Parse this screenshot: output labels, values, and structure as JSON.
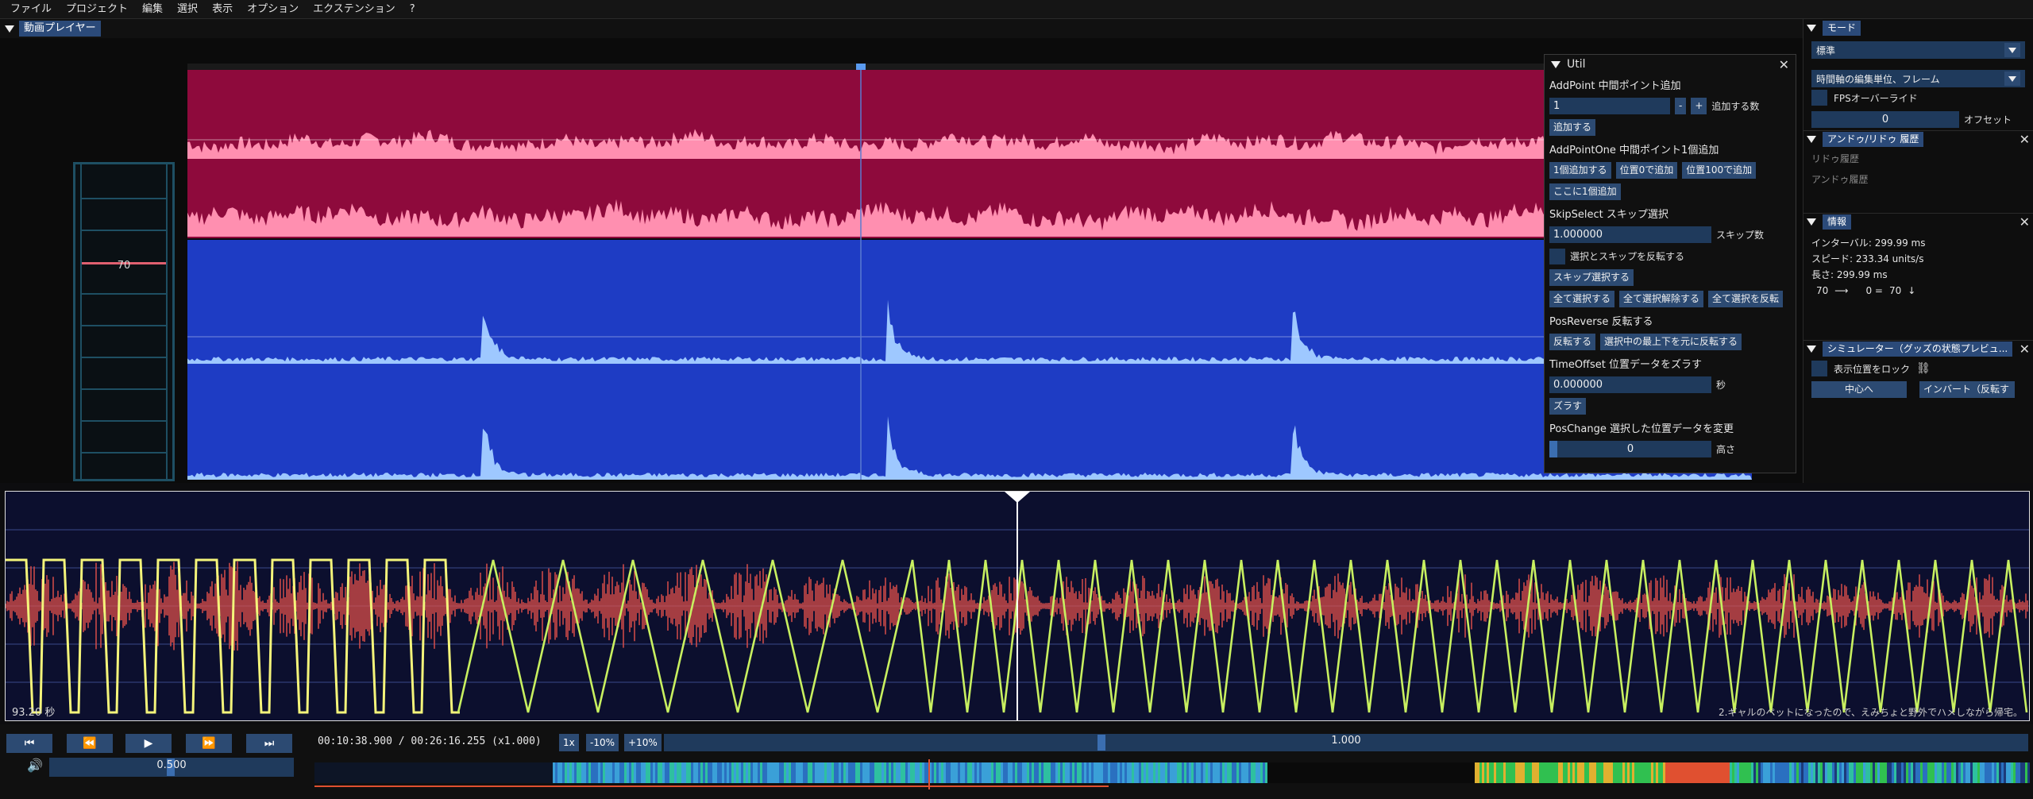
{
  "menu": [
    "ファイル",
    "プロジェクト",
    "編集",
    "選択",
    "表示",
    "オプション",
    "エクステンション",
    "?"
  ],
  "player_tab": "動画プレイヤー",
  "ladder_value": "70",
  "util": {
    "title": "Util",
    "addpoint_title": "AddPoint 中間ポイント追加",
    "addpoint_value": "1",
    "minus": "-",
    "plus": "+",
    "addpoint_count_label": "追加する数",
    "addpoint_btn": "追加する",
    "addpointone_title": "AddPointOne 中間ポイント1個追加",
    "add_one": "1個追加する",
    "pos0": "位置0で追加",
    "pos100": "位置100で追加",
    "add_here": "ここに1個追加",
    "skipselect_title": "SkipSelect スキップ選択",
    "skip_value": "1.000000",
    "skip_label": "スキップ数",
    "invert_label": "選択とスキップを反転する",
    "skip_btn": "スキップ選択する",
    "select_all": "全て選択する",
    "deselect_all": "全て選択解除する",
    "invert_all": "全て選択を反転",
    "posreverse_title": "PosReverse 反転する",
    "reverse_btn": "反転する",
    "reverse_sel_btn": "選択中の最上下を元に反転する",
    "timeoffset_title": "TimeOffset 位置データをズラす",
    "offset_value": "0.000000",
    "offset_unit": "秒",
    "shift_btn": "ズラす",
    "poschange_title": "PosChange 選択した位置データを変更",
    "height_value": "0",
    "height_label": "高さ"
  },
  "right": {
    "mode_tab": "モード",
    "mode_select": "標準",
    "timeunit_select": "時間軸の編集単位、フレーム",
    "fps_override": "FPSオーバーライド",
    "offset_value": "0",
    "offset_label": "オフセット",
    "undo_tab": "アンドゥ/リドゥ 履歴",
    "redo_history": "リドゥ履歴",
    "undo_history": "アンドゥ履歴",
    "info_tab": "情報",
    "interval": "インターバル: 299.99 ms",
    "speed": "スピード: 233.34 units/s",
    "length": "長さ: 299.99 ms",
    "pos_from": "70",
    "pos_mid": "0 =",
    "pos_to": "70",
    "sim_tab": "シミュレーター（グッズの状態プレビュ...",
    "lock_label": "表示位置をロック",
    "center_btn": "中心へ",
    "invert_btn": "インバート（反転す"
  },
  "script": {
    "time_left": "93.20 秒",
    "lyric": "2.ギャルのペットになったので、えみちょと野外でハメしながら帰宅。"
  },
  "transport": {
    "time": "00:10:38.900 / 00:26:16.255 (x1.000)",
    "speed_1x": "1x",
    "speed_minus": "-10%",
    "speed_plus": "+10%",
    "seek_value": "1.000",
    "volume_value": "0.500"
  },
  "colors": {
    "accent": "#2c4a72",
    "wave_red_bg": "#8e0a3c",
    "wave_pink": "#ff8fb0",
    "wave_blue_bg": "#1e3cc4",
    "wave_light_blue": "#9ec8ff",
    "script_line_yellow": "#f4f47a",
    "script_line_green": "#c8f060",
    "audio_red": "#e0504a"
  }
}
